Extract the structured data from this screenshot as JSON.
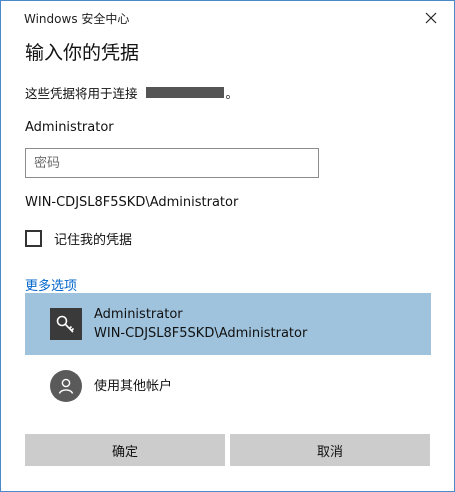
{
  "window": {
    "title": "Windows 安全中心"
  },
  "dialog": {
    "heading": "输入你的凭据",
    "connection_text_before": "这些凭据将用于连接",
    "connection_text_after": "。",
    "username": "Administrator",
    "password_placeholder": "密码",
    "password_value": "",
    "domain_user": "WIN-CDJSL8F5SKD\\Administrator",
    "remember_label": "记住我的凭据",
    "remember_checked": false,
    "more_options": "更多选项"
  },
  "accounts": [
    {
      "name": "Administrator",
      "domain": "WIN-CDJSL8F5SKD\\Administrator",
      "icon": "key-icon",
      "selected": true
    }
  ],
  "other_account": {
    "label": "使用其他帐户",
    "icon": "user-icon"
  },
  "buttons": {
    "ok": "确定",
    "cancel": "取消"
  },
  "colors": {
    "accent_link": "#0066cc",
    "selection": "#9fc3dd",
    "button": "#cccccc",
    "border": "#4a8ac9"
  }
}
